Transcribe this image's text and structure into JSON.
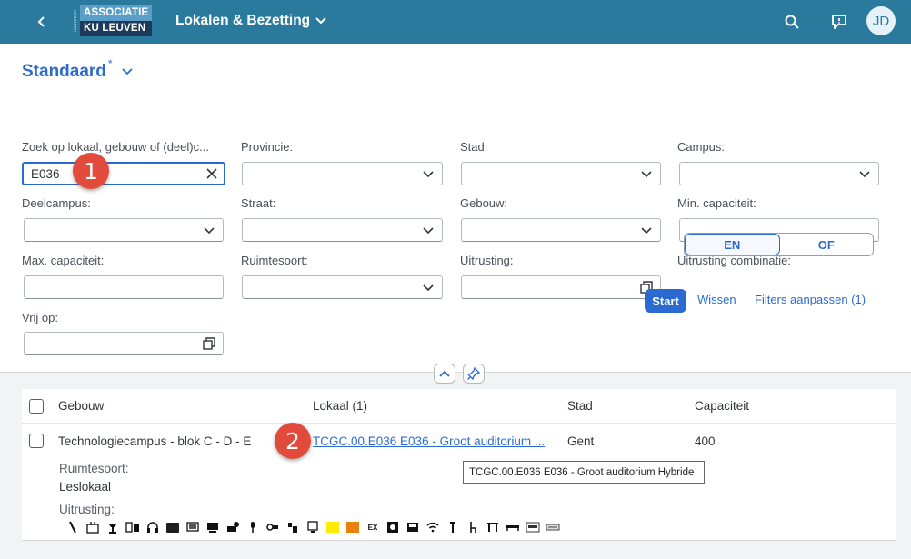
{
  "header": {
    "logo_top": "ASSOCIATIE",
    "logo_bottom": "KU LEUVEN",
    "logo_side": "HOSTED BY",
    "app_title": "Lokalen & Bezetting",
    "avatar_initials": "JD",
    "bg_color": "#2a7a9e"
  },
  "variant": {
    "name": "Standaard",
    "modified_mark": "*"
  },
  "filters": {
    "zoek_label": "Zoek op lokaal, gebouw of (deel)c...",
    "zoek_value": "E036",
    "provincie_label": "Provincie:",
    "stad_label": "Stad:",
    "campus_label": "Campus:",
    "deelcampus_label": "Deelcampus:",
    "straat_label": "Straat:",
    "gebouw_label": "Gebouw:",
    "mincap_label": "Min. capaciteit:",
    "maxcap_label": "Max. capaciteit:",
    "ruimtesoort_label": "Ruimtesoort:",
    "uitrusting_label": "Uitrusting:",
    "uitrusting_comb_label": "Uitrusting combinatie:",
    "vrijop_label": "Vrij op:",
    "seg_en": "EN",
    "seg_of": "OF"
  },
  "actions": {
    "start": "Start",
    "wissen": "Wissen",
    "filters_aanpassen": "Filters aanpassen (1)"
  },
  "table": {
    "col_gebouw": "Gebouw",
    "col_lokaal": "Lokaal (1)",
    "col_stad": "Stad",
    "col_capaciteit": "Capaciteit",
    "row": {
      "gebouw": "Technologiecampus - blok C - D - E",
      "lokaal": "TCGC.00.E036 E036 - Groot auditorium ...",
      "stad": "Gent",
      "capaciteit": "400",
      "ruimtesoort_label": "Ruimtesoort:",
      "ruimtesoort_value": "Leslokaal",
      "uitrusting_label": "Uitrusting:"
    }
  },
  "tooltip": "TCGC.00.E036 E036 - Groot auditorium Hybride",
  "markers": [
    "1",
    "2"
  ],
  "equipment_icons": [
    "pointer-icon",
    "socket-icon",
    "lectern-icon",
    "audio-icon",
    "headset-icon",
    "screen-icon",
    "display-icon",
    "monitor-icon",
    "projector-icon",
    "microphone-icon",
    "connector-icon",
    "remote-icon",
    "printer-icon",
    "yellow-square-icon",
    "orange-square-icon",
    "ex-icon",
    "camera-icon",
    "tv-icon",
    "wifi-icon",
    "desk-icon",
    "chair-icon",
    "table-icon",
    "bench-icon",
    "label-icon",
    "keyboard-icon"
  ],
  "equipment_text": {
    "ex": "EX"
  }
}
